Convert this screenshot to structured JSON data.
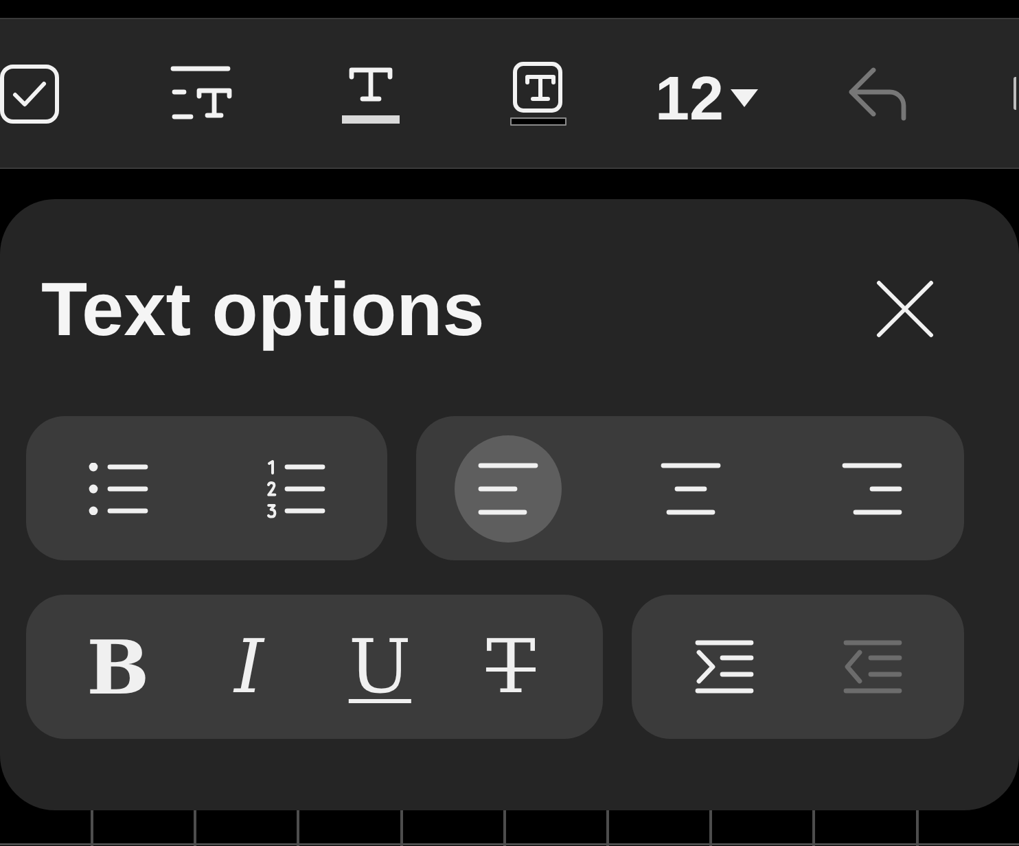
{
  "toolbar": {
    "tools": [
      {
        "kind": "checkbox",
        "disabled": false
      },
      {
        "kind": "text-style",
        "disabled": false
      },
      {
        "kind": "text-color",
        "color": "#d9d9d9",
        "disabled": false
      },
      {
        "kind": "highlight",
        "color": "#000000",
        "disabled": false
      },
      {
        "kind": "font-size",
        "value": "12",
        "disabled": false
      },
      {
        "kind": "undo",
        "disabled": true
      }
    ]
  },
  "panel": {
    "title": "Text options",
    "rows": [
      {
        "groups": [
          {
            "buttons": [
              {
                "kind": "bullet-list",
                "selected": false,
                "disabled": false
              },
              {
                "kind": "numbered-list",
                "selected": false,
                "disabled": false
              }
            ]
          },
          {
            "buttons": [
              {
                "kind": "align-left",
                "selected": true,
                "disabled": false
              },
              {
                "kind": "align-center",
                "selected": false,
                "disabled": false
              },
              {
                "kind": "align-right",
                "selected": false,
                "disabled": false
              }
            ]
          }
        ]
      },
      {
        "groups": [
          {
            "buttons": [
              {
                "kind": "bold",
                "glyph": "B",
                "selected": false,
                "disabled": false
              },
              {
                "kind": "italic",
                "glyph": "I",
                "selected": false,
                "disabled": false
              },
              {
                "kind": "underline",
                "glyph": "U",
                "selected": false,
                "disabled": false
              },
              {
                "kind": "strikethrough",
                "glyph": "T",
                "selected": false,
                "disabled": false
              }
            ]
          },
          {
            "buttons": [
              {
                "kind": "indent",
                "selected": false,
                "disabled": false
              },
              {
                "kind": "outdent",
                "selected": false,
                "disabled": true
              }
            ]
          }
        ]
      }
    ]
  }
}
